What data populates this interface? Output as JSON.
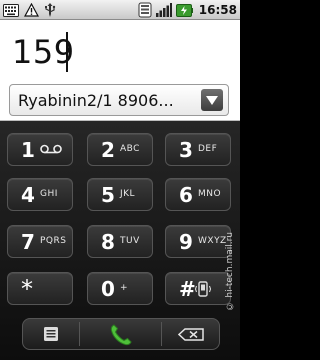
{
  "status_bar": {
    "time": "16:58",
    "left_icons": [
      "keyboard-icon",
      "warning-icon",
      "usb-icon"
    ],
    "right_icons": [
      "sync-icon",
      "signal-icon",
      "battery-charging-icon"
    ]
  },
  "dialer": {
    "digits": "159",
    "suggestion": "Ryabinin2/1 8906..."
  },
  "keypad": {
    "keys": [
      {
        "digit": "1",
        "letters": ""
      },
      {
        "digit": "2",
        "letters": "ABC"
      },
      {
        "digit": "3",
        "letters": "DEF"
      },
      {
        "digit": "4",
        "letters": "GHI"
      },
      {
        "digit": "5",
        "letters": "JKL"
      },
      {
        "digit": "6",
        "letters": "MNO"
      },
      {
        "digit": "7",
        "letters": "PQRS"
      },
      {
        "digit": "8",
        "letters": "TUV"
      },
      {
        "digit": "9",
        "letters": "WXYZ"
      },
      {
        "digit": "*",
        "letters": ""
      },
      {
        "digit": "0",
        "letters": "+"
      },
      {
        "digit": "#",
        "letters": ""
      }
    ]
  },
  "bottom_bar": {
    "icons": [
      "menu-list-icon",
      "call-icon",
      "backspace-icon"
    ]
  },
  "watermark": "© hi-tech.mail.ru",
  "colors": {
    "call_green": "#4fbf3a",
    "key_bg": "#2e2e2e"
  }
}
